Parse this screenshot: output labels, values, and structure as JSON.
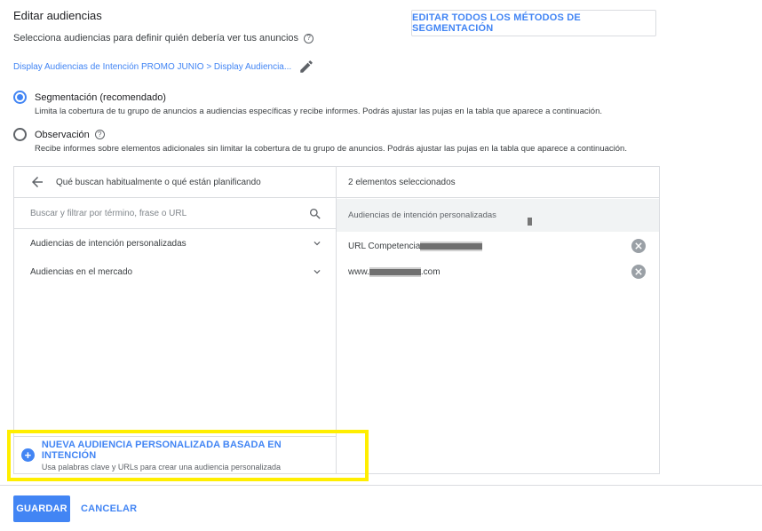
{
  "header": {
    "title": "Editar audiencias",
    "subtitle": "Selecciona audiencias para definir quién debería ver tus anuncios",
    "edit_all_label": "EDITAR TODOS LOS MÉTODOS DE SEGMENTACIÓN",
    "breadcrumb": "Display Audiencias de Intención PROMO JUNIO > Display Audiencia..."
  },
  "modes": [
    {
      "label": "Segmentación (recomendado)",
      "description": "Limita la cobertura de tu grupo de anuncios a audiencias específicas y recibe informes. Podrás ajustar las pujas en la tabla que aparece a continuación.",
      "selected": true
    },
    {
      "label": "Observación",
      "description": "Recibe informes sobre elementos adicionales sin limitar la cobertura de tu grupo de anuncios. Podrás ajustar las pujas en la tabla que aparece a continuación.",
      "selected": false
    }
  ],
  "browse": {
    "header": "Qué buscan habitualmente o qué están planificando",
    "search_placeholder": "Buscar y filtrar por término, frase o URL",
    "items": [
      {
        "label": "Audiencias de intención personalizadas"
      },
      {
        "label": "Audiencias en el mercado"
      }
    ],
    "new_audience_title": "NUEVA AUDIENCIA PERSONALIZADA BASADA EN INTENCIÓN",
    "new_audience_desc": "Usa palabras clave y URLs para crear una audiencia personalizada"
  },
  "selected": {
    "header": "2 elementos seleccionados",
    "group": "Audiencias de intención personalizadas",
    "items": [
      {
        "prefix": "URL Competencia",
        "suffix": ""
      },
      {
        "prefix": "www.",
        "suffix": ".com"
      }
    ]
  },
  "footer": {
    "save_label": "GUARDAR",
    "cancel_label": "CANCELAR"
  },
  "colors": {
    "accent": "#4285f4",
    "highlight": "#ffee00"
  }
}
